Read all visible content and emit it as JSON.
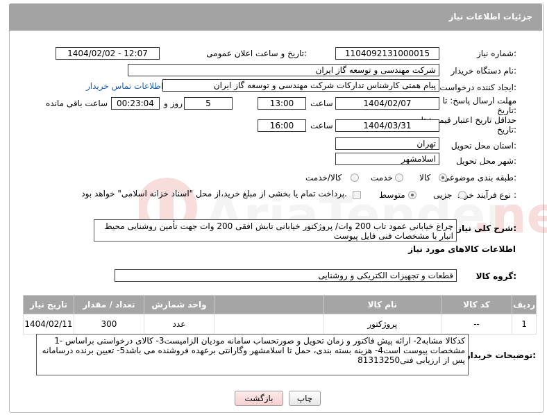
{
  "panel_title": "جزئیات اطلاعات نیاز",
  "fields": {
    "need_number_label": "شماره نیاز:",
    "need_number": "1104092131000015",
    "announce_label": "تاریخ و ساعت اعلان عمومی:",
    "announce_value": "1404/02/02 - 12:07",
    "buyer_org_label": "نام دستگاه خریدار:",
    "buyer_org": "شرکت مهندسی و توسعه گاز ایران",
    "requester_label": "ایجاد کننده درخواست:",
    "requester": "پیام همتی کارشناس تدارکات شرکت مهندسی و توسعه گاز ایران",
    "contact_link": "اطلاعات تماس خریدار",
    "deadline_label": "مهلت ارسال پاسخ: تا تاریخ:",
    "deadline_date": "1404/02/07",
    "time_label": "ساعت",
    "deadline_time": "13:00",
    "days_value": "5",
    "days_label": "روز و",
    "remaining_time": "00:23:04",
    "remaining_label": "ساعت باقی مانده",
    "validity_label": "حداقل تاریخ اعتبار قیمت: تا تاریخ:",
    "validity_date": "1404/03/31",
    "validity_time": "16:00",
    "province_label": "استان محل تحویل:",
    "province": "تهران",
    "city_label": "شهر محل تحویل:",
    "city": "اسلامشهر",
    "category_label": "طبقه بندی موضوعی:",
    "category_options": [
      "کالا",
      "خدمت",
      "کالا/خدمت"
    ],
    "process_label": "نوع فرآیند خرید :",
    "process_options": [
      "جزیی",
      "متوسط"
    ],
    "payment_note": "پرداخت تمام یا بخشی از مبلغ خرید،از محل \"اسناد خزانه اسلامی\" خواهد بود."
  },
  "description": {
    "label": "شرح کلی نیاز:",
    "text": "چراغ خیابانی عمود تاب 200 وات/ پروژکتور خیابانی تابش افقی 200 وات جهت تأمین روشنایی محیط انبار با مشخصات فنی فایل پیوست"
  },
  "goods_info_title": "اطلاعات کالاهای مورد نیاز",
  "goods_group": {
    "label": "گروه کالا:",
    "value": "قطعات و تجهیزات الکتریکی و روشنایی"
  },
  "table": {
    "headers": [
      "ردیف",
      "کد کالا",
      "نام کالا",
      "واحد شمارش",
      "تعداد / مقدار",
      "تاریخ نیاز"
    ],
    "rows": [
      [
        "1",
        "--",
        "پروژکتور",
        "عدد",
        "300",
        "1404/02/11"
      ]
    ]
  },
  "buyer_notes": {
    "label": "توضیحات خریدار:",
    "text": "1- کدکالا مشابه2- ارائه پیش فاکتور و زمان تحویل و صورتحساب سامانه مودیان  الزامیست3- کالای درخواستی براساس مشخصات پیوست است4- هزینه بسته بندی، حمل تا اسلامشهر وگارانتی برعهده فروشنده می باشد5- تعیین برنده درسامانه پس از ارزیابی فنی81313250"
  },
  "buttons": {
    "print": "چاپ",
    "back": "بازگشت"
  },
  "watermark_text": "AriaTender.net"
}
